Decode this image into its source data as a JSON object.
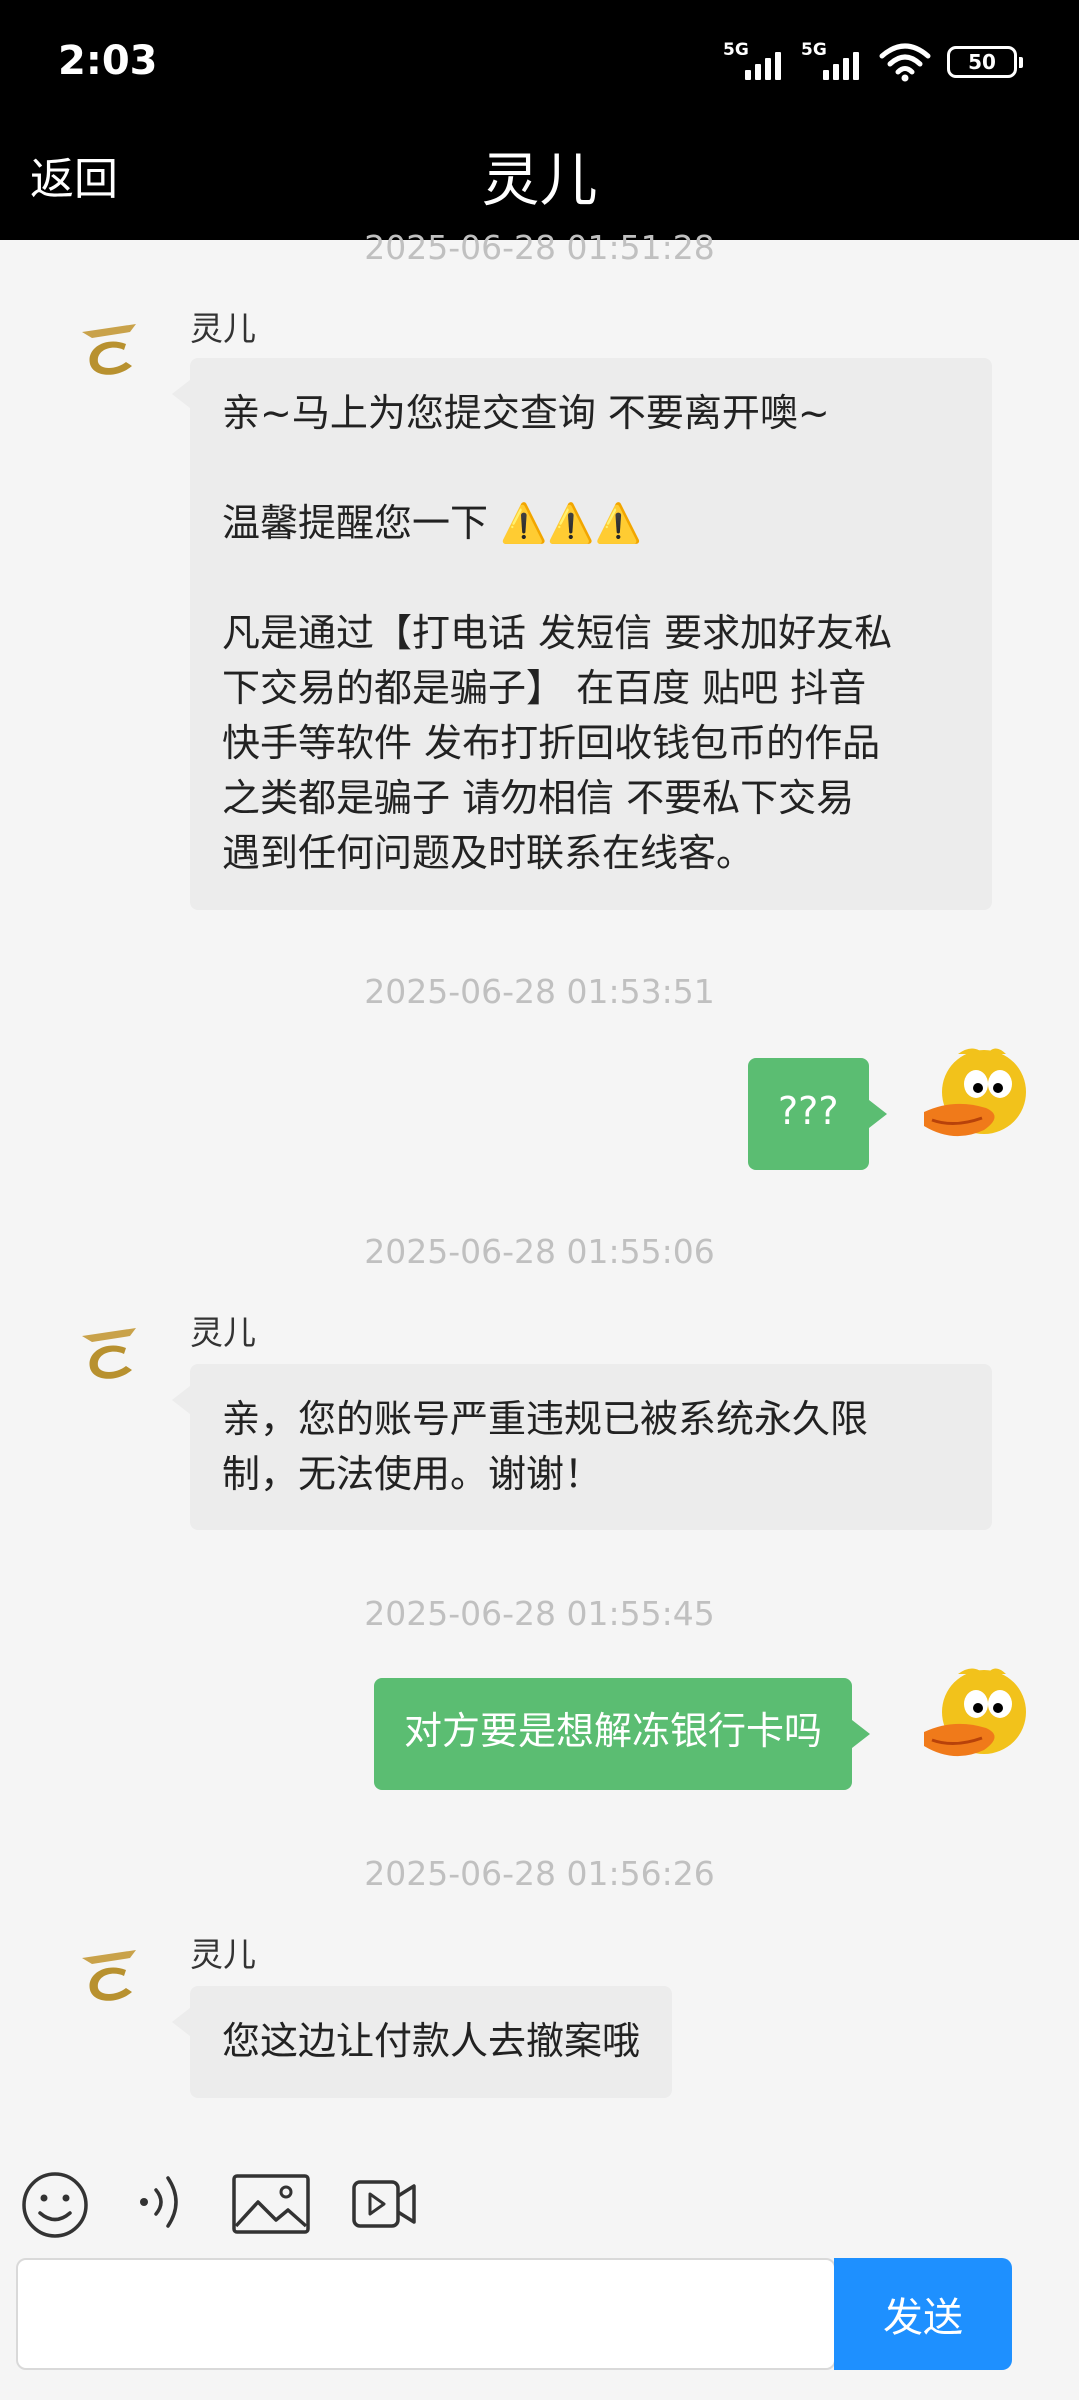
{
  "status_bar": {
    "time": "2:03",
    "sim1": "5G",
    "sim2": "5G",
    "battery": "50"
  },
  "header": {
    "back_label": "返回",
    "title": "灵儿"
  },
  "messages": [
    {
      "type": "timestamp",
      "text": "2025-06-28 01:51:28"
    },
    {
      "type": "incoming",
      "sender": "灵儿",
      "paragraphs": [
        [
          "亲~马上为您提交查询  不要离开噢~"
        ],
        [
          "温馨提醒您一下 ⚠️⚠️⚠️"
        ],
        [
          "凡是通过【打电话 发短信  要求加好友私",
          "下交易的都是骗子】 在百度 贴吧 抖音",
          "快手等软件 发布打折回收钱包币的作品",
          "之类都是骗子  请勿相信   不要私下交易",
          "遇到任何问题及时联系在线客。"
        ]
      ]
    },
    {
      "type": "timestamp",
      "text": "2025-06-28 01:53:51"
    },
    {
      "type": "outgoing",
      "text": "???"
    },
    {
      "type": "timestamp",
      "text": "2025-06-28 01:55:06"
    },
    {
      "type": "incoming",
      "sender": "灵儿",
      "paragraphs": [
        [
          "亲，您的账号严重违规已被系统永久限",
          "制，无法使用。谢谢！"
        ]
      ]
    },
    {
      "type": "timestamp",
      "text": "2025-06-28 01:55:45"
    },
    {
      "type": "outgoing",
      "text": "对方要是想解冻银行卡吗"
    },
    {
      "type": "timestamp",
      "text": "2025-06-28 01:56:26"
    },
    {
      "type": "incoming",
      "sender": "灵儿",
      "paragraphs": [
        [
          "您这边让付款人去撤案哦"
        ]
      ]
    }
  ],
  "input": {
    "placeholder": "",
    "value": ""
  },
  "send_label": "发送",
  "icons": [
    "emoji-icon",
    "voice-icon",
    "image-icon",
    "video-icon"
  ],
  "colors": {
    "outgoing_bubble": "#5bbd72",
    "incoming_bubble": "#ececec",
    "send_button": "#1e90ff",
    "header_bg": "#000000"
  }
}
